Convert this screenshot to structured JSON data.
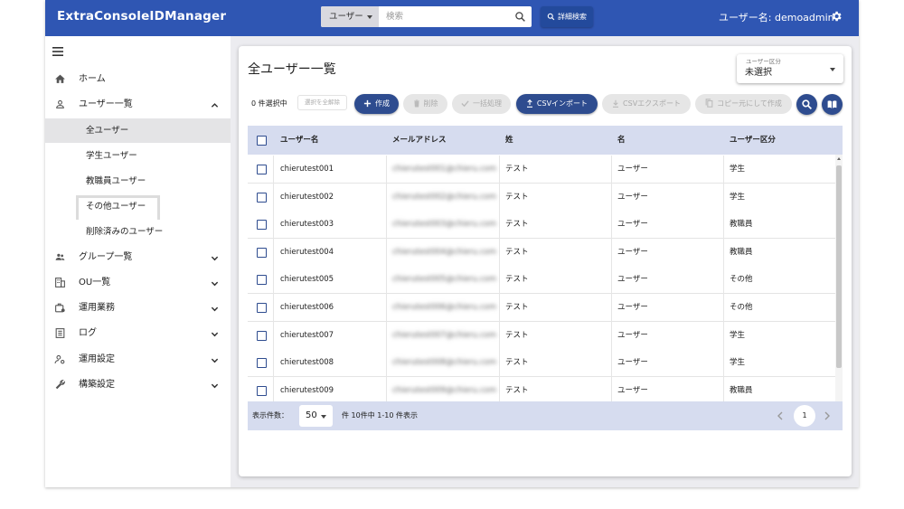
{
  "app": {
    "title": "ExtraConsoleIDManager",
    "username": "ユーザー名: demoadmin"
  },
  "search": {
    "type_label": "ユーザー",
    "placeholder": "検索",
    "advanced_label": "詳細検索"
  },
  "sidebar": {
    "items": [
      {
        "label": "ホーム",
        "icon": "home-icon"
      },
      {
        "label": "ユーザー一覧",
        "icon": "person-icon",
        "expanded": true
      },
      {
        "label": "グループ一覧",
        "icon": "group-icon"
      },
      {
        "label": "OU一覧",
        "icon": "building-icon"
      },
      {
        "label": "運用業務",
        "icon": "work-icon"
      },
      {
        "label": "ログ",
        "icon": "log-icon"
      },
      {
        "label": "運用設定",
        "icon": "settings-people-icon"
      },
      {
        "label": "構築設定",
        "icon": "wrench-icon"
      }
    ],
    "user_subitems": [
      {
        "label": "全ユーザー",
        "active": true
      },
      {
        "label": "学生ユーザー"
      },
      {
        "label": "教職員ユーザー"
      },
      {
        "label": "その他ユーザー"
      },
      {
        "label": "削除済みのユーザー"
      }
    ]
  },
  "main": {
    "title": "全ユーザー一覧",
    "user_type_label": "ユーザー区分",
    "user_type_value": "未選択",
    "selected_count": "0 件選択中",
    "deselect_all": "選択を全解除",
    "buttons": {
      "create": "作成",
      "delete": "削除",
      "bulk": "一括処理",
      "csv_import": "CSVインポート",
      "csv_export": "CSVエクスポート",
      "copy_create": "コピー元にして作成"
    },
    "colors": {
      "primary": "#2e4c8f",
      "header_bg": "#2f56b3",
      "table_header_bg": "#d6dcef"
    }
  },
  "table": {
    "headers": [
      "ユーザー名",
      "メールアドレス",
      "姓",
      "名",
      "ユーザー区分"
    ],
    "rows": [
      {
        "username": "chierutest001",
        "email": "chierutest001@chieru.com",
        "last": "テスト",
        "first": "ユーザー",
        "type": "学生"
      },
      {
        "username": "chierutest002",
        "email": "chierutest002@chieru.com",
        "last": "テスト",
        "first": "ユーザー",
        "type": "学生"
      },
      {
        "username": "chierutest003",
        "email": "chierutest003@chieru.com",
        "last": "テスト",
        "first": "ユーザー",
        "type": "教職員"
      },
      {
        "username": "chierutest004",
        "email": "chierutest004@chieru.com",
        "last": "テスト",
        "first": "ユーザー",
        "type": "教職員"
      },
      {
        "username": "chierutest005",
        "email": "chierutest005@chieru.com",
        "last": "テスト",
        "first": "ユーザー",
        "type": "その他"
      },
      {
        "username": "chierutest006",
        "email": "chierutest006@chieru.com",
        "last": "テスト",
        "first": "ユーザー",
        "type": "その他"
      },
      {
        "username": "chierutest007",
        "email": "chierutest007@chieru.com",
        "last": "テスト",
        "first": "ユーザー",
        "type": "学生"
      },
      {
        "username": "chierutest008",
        "email": "chierutest008@chieru.com",
        "last": "テスト",
        "first": "ユーザー",
        "type": "学生"
      },
      {
        "username": "chierutest009",
        "email": "chierutest009@chieru.com",
        "last": "テスト",
        "first": "ユーザー",
        "type": "教職員"
      }
    ]
  },
  "pagination": {
    "per_page_label": "表示件数：",
    "per_page": "50",
    "info": "件 10件中 1-10 件表示",
    "current_page": "1"
  }
}
